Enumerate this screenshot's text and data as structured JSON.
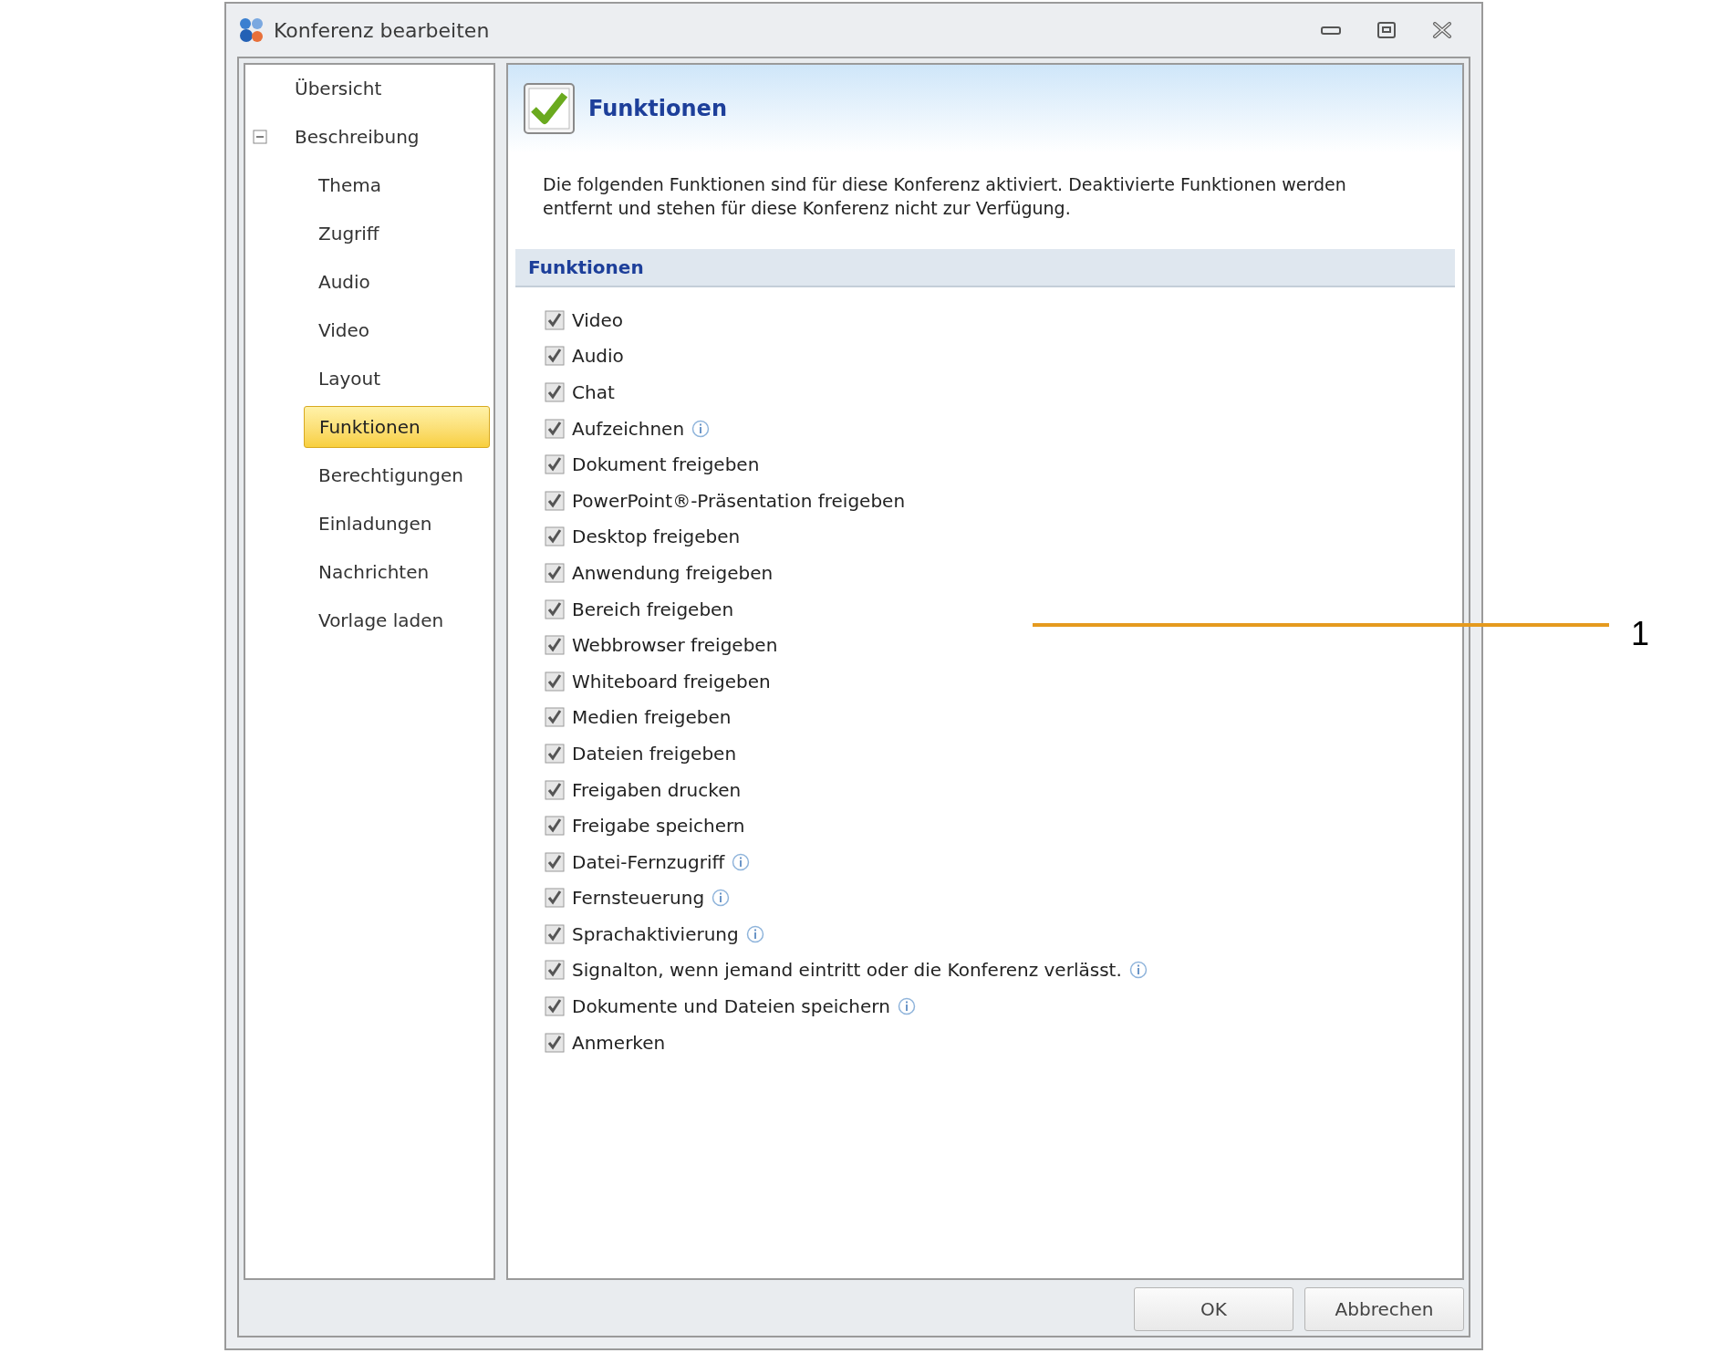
{
  "window": {
    "title": "Konferenz bearbeiten"
  },
  "sidebar": {
    "items": [
      {
        "label": "Übersicht",
        "selected": false
      },
      {
        "label": "Beschreibung",
        "selected": false,
        "expanded": true,
        "children": [
          {
            "label": "Thema",
            "selected": false
          },
          {
            "label": "Zugriff",
            "selected": false
          },
          {
            "label": "Audio",
            "selected": false
          },
          {
            "label": "Video",
            "selected": false
          },
          {
            "label": "Layout",
            "selected": false
          },
          {
            "label": "Funktionen",
            "selected": true
          },
          {
            "label": "Berechtigungen",
            "selected": false
          },
          {
            "label": "Einladungen",
            "selected": false
          },
          {
            "label": "Nachrichten",
            "selected": false
          },
          {
            "label": "Vorlage laden",
            "selected": false
          }
        ]
      }
    ]
  },
  "panel": {
    "title": "Funktionen",
    "description": "Die folgenden Funktionen sind für diese Konferenz aktiviert. Deaktivierte Funktionen werden entfernt und stehen für diese Konferenz nicht zur Verfügung.",
    "section": "Funktionen",
    "features": [
      {
        "label": "Video",
        "checked": true,
        "info": false
      },
      {
        "label": "Audio",
        "checked": true,
        "info": false
      },
      {
        "label": "Chat",
        "checked": true,
        "info": false
      },
      {
        "label": "Aufzeichnen",
        "checked": true,
        "info": true
      },
      {
        "label": "Dokument freigeben",
        "checked": true,
        "info": false
      },
      {
        "label": "PowerPoint®-Präsentation freigeben",
        "checked": true,
        "info": false
      },
      {
        "label": "Desktop freigeben",
        "checked": true,
        "info": false
      },
      {
        "label": "Anwendung freigeben",
        "checked": true,
        "info": false
      },
      {
        "label": "Bereich freigeben",
        "checked": true,
        "info": false
      },
      {
        "label": "Webbrowser freigeben",
        "checked": true,
        "info": false
      },
      {
        "label": "Whiteboard freigeben",
        "checked": true,
        "info": false
      },
      {
        "label": "Medien freigeben",
        "checked": true,
        "info": false
      },
      {
        "label": "Dateien freigeben",
        "checked": true,
        "info": false
      },
      {
        "label": "Freigaben drucken",
        "checked": true,
        "info": false
      },
      {
        "label": "Freigabe speichern",
        "checked": true,
        "info": false
      },
      {
        "label": "Datei-Fernzugriff",
        "checked": true,
        "info": true
      },
      {
        "label": "Fernsteuerung",
        "checked": true,
        "info": true
      },
      {
        "label": "Sprachaktivierung",
        "checked": true,
        "info": true
      },
      {
        "label": "Signalton, wenn jemand eintritt oder die Konferenz verlässt.",
        "checked": true,
        "info": true
      },
      {
        "label": "Dokumente und Dateien speichern",
        "checked": true,
        "info": true
      },
      {
        "label": "Anmerken",
        "checked": true,
        "info": false
      }
    ]
  },
  "buttons": [
    "OK",
    "Abbrechen"
  ],
  "callout": {
    "label": "1"
  }
}
